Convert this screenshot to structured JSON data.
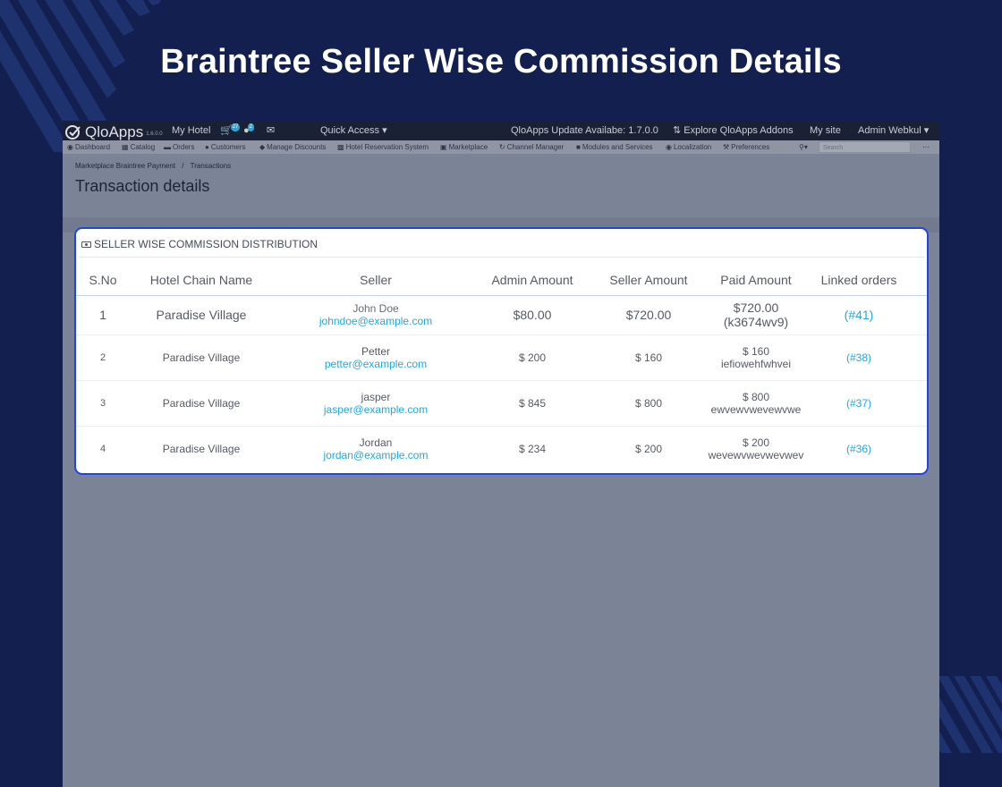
{
  "banner": {
    "title": "Braintree Seller Wise Commission Details"
  },
  "topbar": {
    "logo": "QloApps",
    "version": "1.6.0.0",
    "shop": "My Hotel",
    "cart_badge": "27",
    "customer_badge": "2",
    "quick_access": "Quick Access",
    "update_notice": "QloApps Update Availabe: 1.7.0.0",
    "explore_addons": "Explore QloApps Addons",
    "my_site": "My site",
    "admin_user": "Admin Webkul"
  },
  "menu": {
    "items": [
      "Dashboard",
      "Catalog",
      "Orders",
      "Customers",
      "Manage Discounts",
      "Hotel Reservation System",
      "Marketplace",
      "Channel Manager",
      "Modules and Services",
      "Localization",
      "Preferences"
    ],
    "search_placeholder": "Search"
  },
  "breadcrumb": {
    "parent": "Marketplace Braintree Payment",
    "separator": "/",
    "current": "Transactions"
  },
  "page": {
    "title": "Transaction details"
  },
  "panel": {
    "title": "SELLER WISE COMMISSION DISTRIBUTION",
    "columns": [
      "S.No",
      "Hotel Chain Name",
      "Seller",
      "Admin Amount",
      "Seller Amount",
      "Paid Amount",
      "Linked orders"
    ],
    "rows": [
      {
        "sno": "1",
        "hotel": "Paradise Village",
        "seller_name": "John Doe",
        "seller_email": "johndoe@example.com",
        "admin_amount": "$80.00",
        "seller_amount": "$720.00",
        "paid_amount": "$720.00",
        "paid_id": "(k3674wv9)",
        "linked_order": "(#41)"
      },
      {
        "sno": "2",
        "hotel": "Paradise Village",
        "seller_name": "Petter",
        "seller_email": "petter@example.com",
        "admin_amount": "$ 200",
        "seller_amount": "$ 160",
        "paid_amount": "$ 160",
        "paid_id": "iefiowehfwhvei",
        "linked_order": "(#38)"
      },
      {
        "sno": "3",
        "hotel": "Paradise Village",
        "seller_name": "jasper",
        "seller_email": "jasper@example.com",
        "admin_amount": "$ 845",
        "seller_amount": "$ 800",
        "paid_amount": "$ 800",
        "paid_id": "ewvewvwevewvwe",
        "linked_order": "(#37)"
      },
      {
        "sno": "4",
        "hotel": "Paradise Village",
        "seller_name": "Jordan",
        "seller_email": "jordan@example.com",
        "admin_amount": "$ 234",
        "seller_amount": "$ 200",
        "paid_amount": "$ 200",
        "paid_id": "wevewvwevwevwev",
        "linked_order": "(#36)"
      }
    ]
  },
  "colors": {
    "background": "#121f4f",
    "panel_border": "#2245e0",
    "link": "#1fa9e0"
  }
}
